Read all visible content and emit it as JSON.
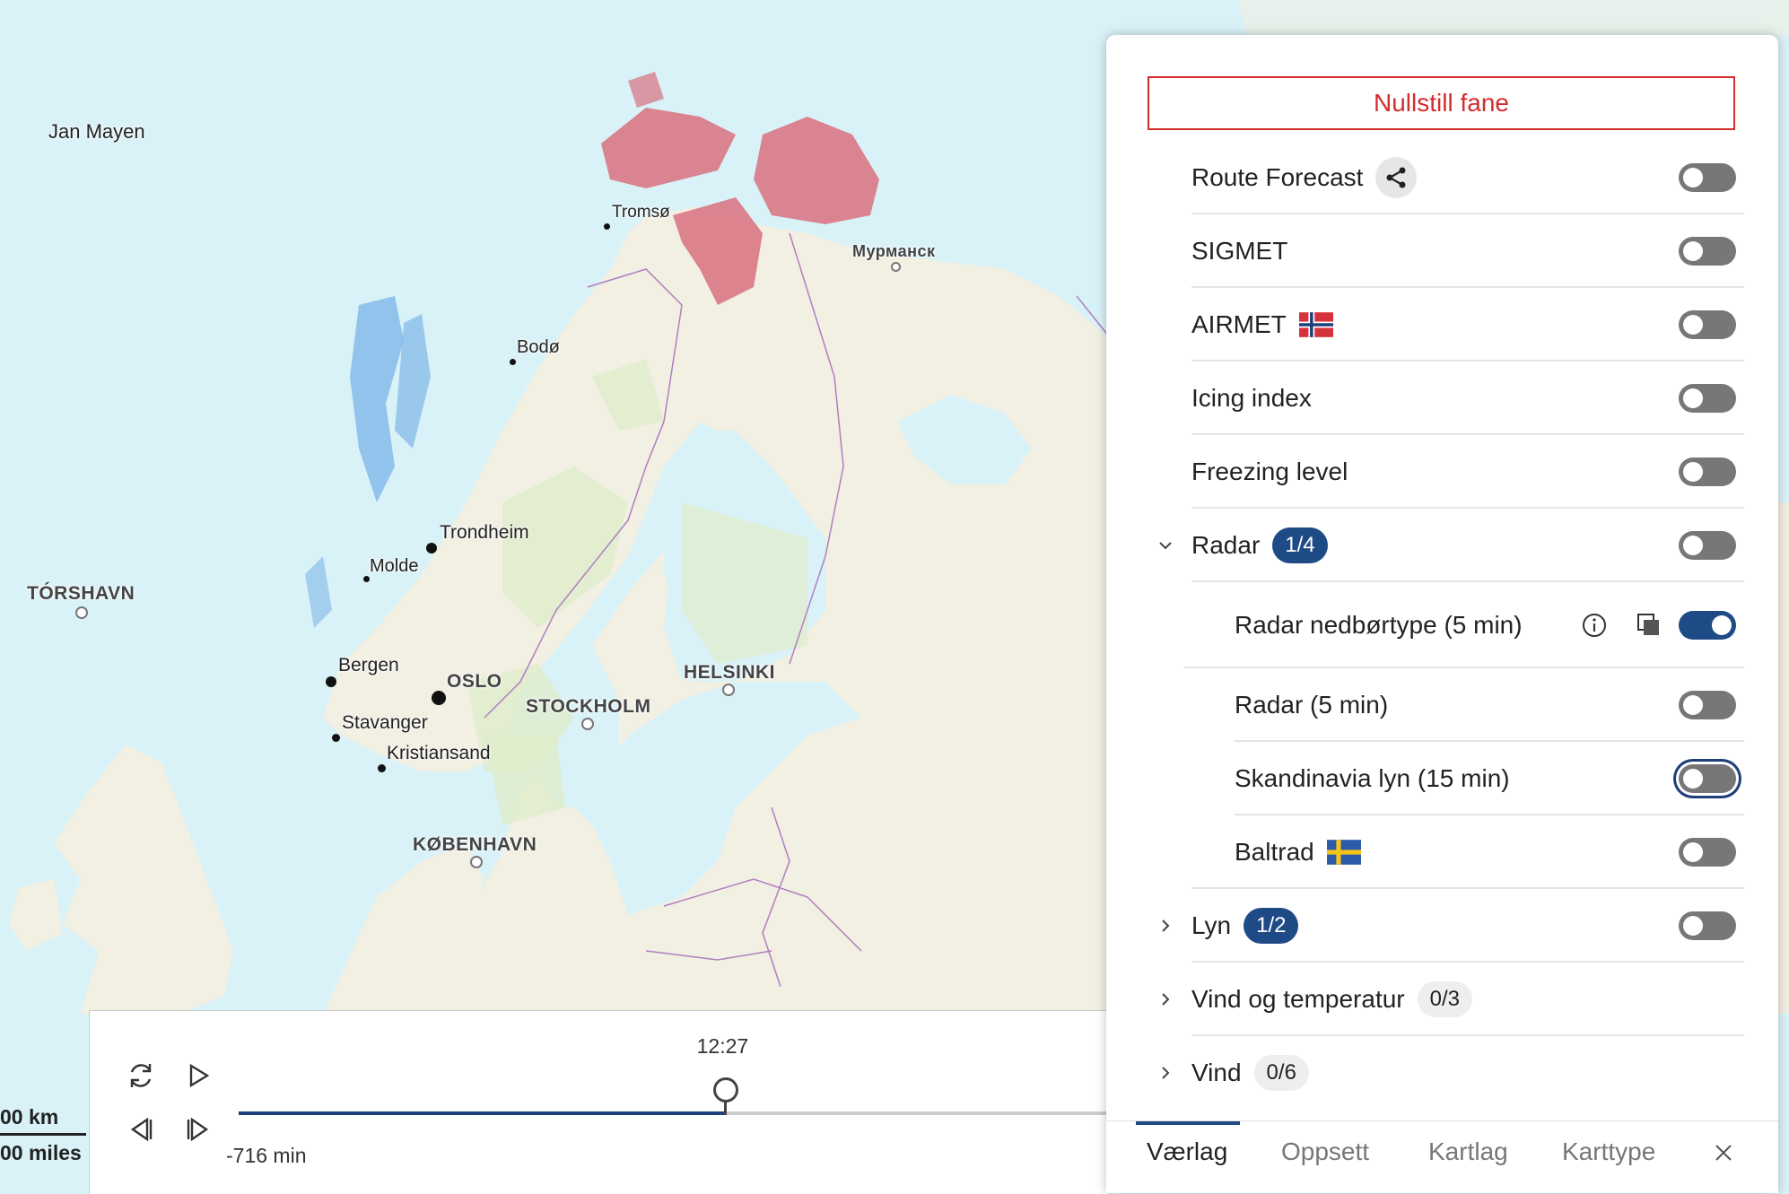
{
  "map": {
    "labels": {
      "jan_mayen": "Jan Mayen",
      "torshavn": "TÓRSHAVN",
      "tromso": "Tromsø",
      "murmansk": "Мурманск",
      "bodo": "Bodø",
      "trondheim": "Trondheim",
      "molde": "Molde",
      "bergen": "Bergen",
      "oslo": "OSLO",
      "stavanger": "Stavanger",
      "kristiansand": "Kristiansand",
      "stockholm": "STOCKHOLM",
      "helsinki": "HELSINKI",
      "kobenhavn": "KØBENHAVN"
    },
    "colors": {
      "sea": "#d9f2f8",
      "land": "#f2efe3",
      "forest": "#dfeccb",
      "radar": "#d9707f",
      "rain": "#7fb6e8",
      "border": "#b07fc0"
    }
  },
  "scale": {
    "km": "00 km",
    "miles": "00 miles"
  },
  "timeline": {
    "current_time": "12:27",
    "offset": "-716 min",
    "progress": 0.56
  },
  "panel": {
    "reset_label": "Nullstill fane",
    "layers": [
      {
        "label": "Route Forecast",
        "on": false
      },
      {
        "label": "SIGMET",
        "on": false
      },
      {
        "label": "AIRMET",
        "on": false
      },
      {
        "label": "Icing index",
        "on": false
      },
      {
        "label": "Freezing level",
        "on": false
      },
      {
        "label": "Radar",
        "badge": "1/4",
        "on": false,
        "expanded": true
      },
      {
        "label": "Radar nedbørtype (5 min)",
        "on": true
      },
      {
        "label": "Radar (5 min)",
        "on": false
      },
      {
        "label": "Skandinavia lyn (15 min)",
        "on": false
      },
      {
        "label": "Baltrad",
        "on": false
      },
      {
        "label": "Lyn",
        "badge": "1/2",
        "on": false
      },
      {
        "label": "Vind og temperatur",
        "badge": "0/3"
      },
      {
        "label": "Vind",
        "badge": "0/6"
      }
    ],
    "tabs": [
      "Værlag",
      "Oppsett",
      "Kartlag",
      "Karttype"
    ]
  }
}
